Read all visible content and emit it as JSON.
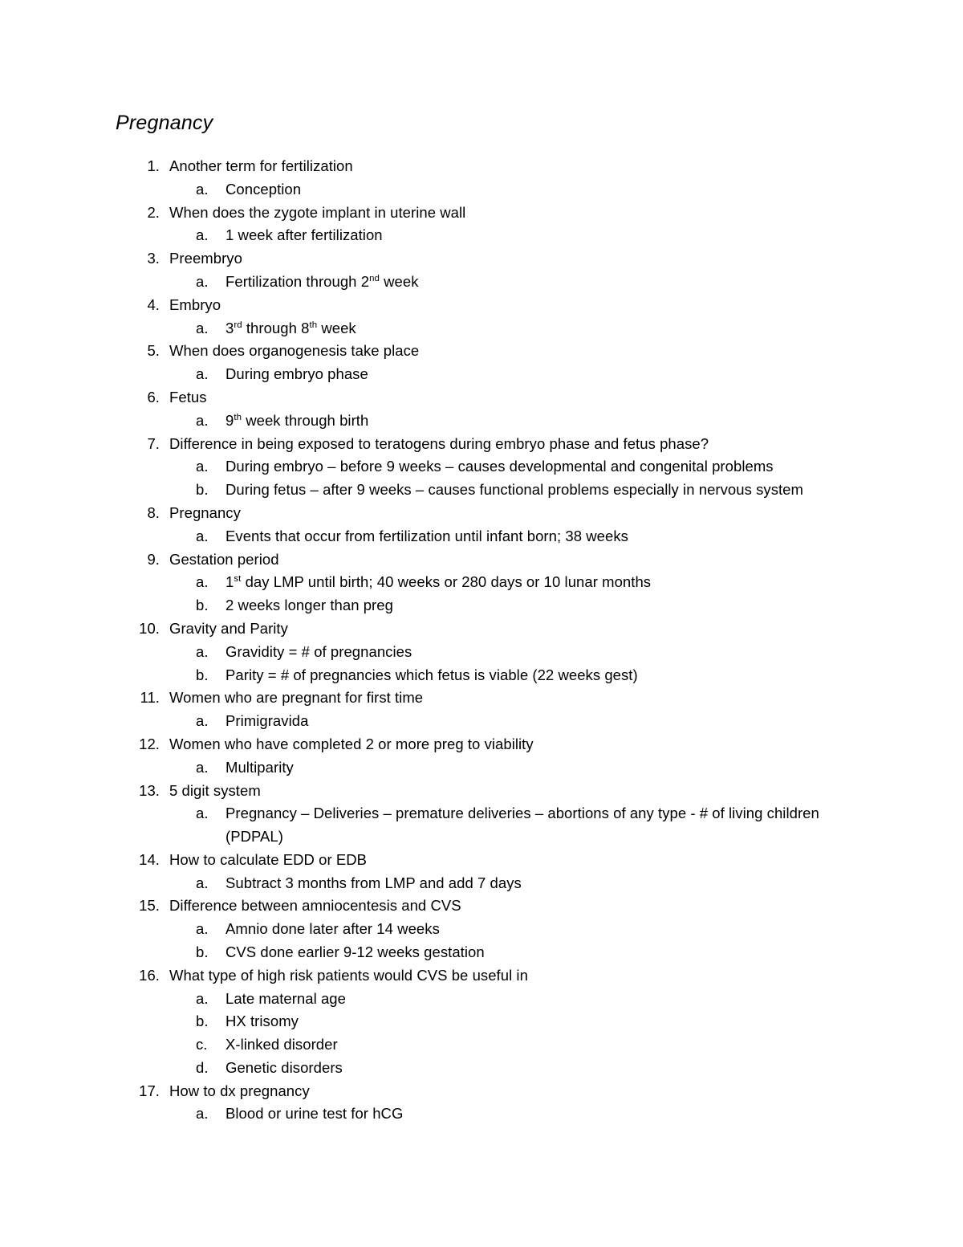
{
  "document": {
    "title": "Pregnancy",
    "background_color": "#ffffff",
    "text_color": "#000000"
  },
  "outline": [
    {
      "number": "1.",
      "text": "Another term for fertilization",
      "subs": [
        {
          "marker": "a.",
          "text": "Conception"
        }
      ]
    },
    {
      "number": "2.",
      "text": "When does the zygote implant in uterine wall",
      "subs": [
        {
          "marker": "a.",
          "text": "1 week after fertilization"
        }
      ]
    },
    {
      "number": "3.",
      "text": "Preembryo",
      "subs": [
        {
          "marker": "a.",
          "text": "Fertilization through 2nd week",
          "pre": "Fertilization through 2",
          "sup": "nd",
          "post": " week"
        }
      ]
    },
    {
      "number": "4.",
      "text": "Embryo",
      "subs": [
        {
          "marker": "a.",
          "text": "3rd through 8th week",
          "pre": "3",
          "sup": "rd",
          "mid": " through 8",
          "sup2": "th",
          "post": " week"
        }
      ]
    },
    {
      "number": "5.",
      "text": "When does organogenesis take place",
      "subs": [
        {
          "marker": "a.",
          "text": "During embryo phase"
        }
      ]
    },
    {
      "number": "6.",
      "text": "Fetus",
      "subs": [
        {
          "marker": "a.",
          "text": "9th week through birth",
          "pre": "9",
          "sup": "th",
          "post": " week through birth"
        }
      ]
    },
    {
      "number": "7.",
      "text": "Difference in being exposed to teratogens during embryo phase and fetus phase?",
      "subs": [
        {
          "marker": "a.",
          "text": "During embryo – before 9 weeks – causes developmental and congenital problems"
        },
        {
          "marker": "b.",
          "text": "During fetus – after 9 weeks – causes functional problems especially in nervous system"
        }
      ]
    },
    {
      "number": "8.",
      "text": "Pregnancy",
      "subs": [
        {
          "marker": "a.",
          "text": "Events that occur from fertilization until infant born; 38 weeks"
        }
      ]
    },
    {
      "number": "9.",
      "text": "Gestation period",
      "subs": [
        {
          "marker": "a.",
          "text": "1st day LMP until birth; 40 weeks or 280 days or 10 lunar months",
          "pre": "1",
          "sup": "st",
          "post": " day LMP until birth; 40 weeks or 280 days or 10 lunar months"
        },
        {
          "marker": "b.",
          "text": "2 weeks longer than preg"
        }
      ]
    },
    {
      "number": "10.",
      "text": "Gravity and Parity",
      "subs": [
        {
          "marker": "a.",
          "text": "Gravidity = # of pregnancies"
        },
        {
          "marker": "b.",
          "text": "Parity = # of pregnancies which fetus is viable (22 weeks gest)"
        }
      ]
    },
    {
      "number": "11.",
      "text": "Women who are pregnant for first time",
      "subs": [
        {
          "marker": "a.",
          "text": "Primigravida"
        }
      ]
    },
    {
      "number": "12.",
      "text": "Women who have completed 2 or more preg to viability",
      "subs": [
        {
          "marker": "a.",
          "text": "Multiparity"
        }
      ]
    },
    {
      "number": "13.",
      "text": "5 digit system",
      "subs": [
        {
          "marker": "a.",
          "text": "Pregnancy – Deliveries – premature deliveries – abortions of any type - # of living children   (PDPAL)"
        }
      ]
    },
    {
      "number": "14.",
      "text": "How to calculate EDD or EDB",
      "subs": [
        {
          "marker": "a.",
          "text": "Subtract 3 months from LMP and add 7 days"
        }
      ]
    },
    {
      "number": "15.",
      "text": "Difference between amniocentesis and CVS",
      "subs": [
        {
          "marker": "a.",
          "text": "Amnio done later after 14 weeks"
        },
        {
          "marker": "b.",
          "text": "CVS done earlier 9-12 weeks gestation"
        }
      ]
    },
    {
      "number": "16.",
      "text": "What type of high risk patients would CVS be useful in",
      "subs": [
        {
          "marker": "a.",
          "text": "Late maternal age"
        },
        {
          "marker": "b.",
          "text": "HX trisomy"
        },
        {
          "marker": "c.",
          "text": "X-linked disorder"
        },
        {
          "marker": "d.",
          "text": "Genetic disorders"
        }
      ]
    },
    {
      "number": "17.",
      "text": "How to dx pregnancy",
      "subs": [
        {
          "marker": "a.",
          "text": "Blood or urine test for hCG"
        }
      ]
    }
  ]
}
